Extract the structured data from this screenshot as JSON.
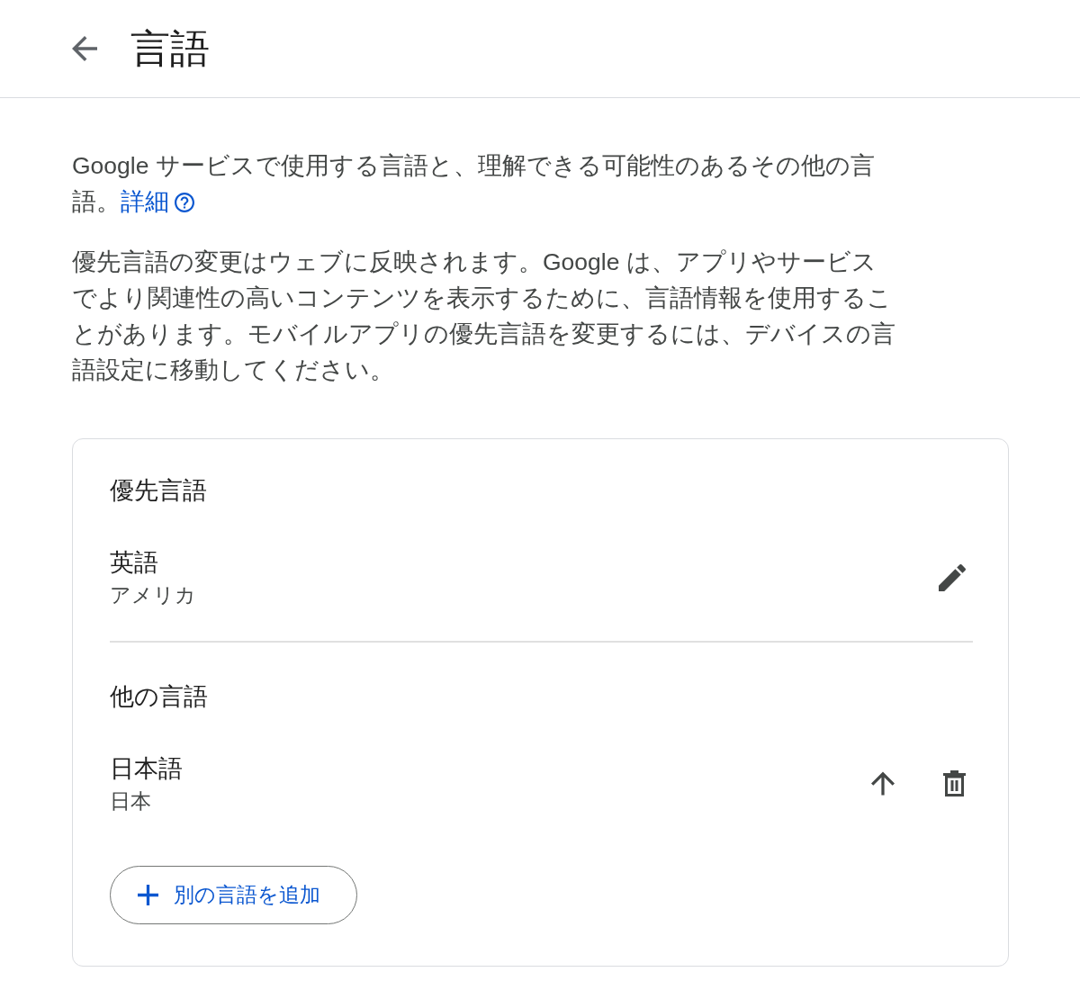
{
  "header": {
    "title": "言語"
  },
  "intro": {
    "text": "Google サービスで使用する言語と、理解できる可能性のあるその他の言語。",
    "link": "詳細"
  },
  "note": "優先言語の変更はウェブに反映されます。Google は、アプリやサービスでより関連性の高いコンテンツを表示するために、言語情報を使用することがあります。モバイルアプリの優先言語を変更するには、デバイスの言語設定に移動してください。",
  "card": {
    "sections": [
      {
        "title": "優先言語",
        "languages": [
          {
            "name": "英語",
            "region": "アメリカ",
            "actions": [
              {
                "kind": "edit"
              }
            ]
          }
        ]
      },
      {
        "title": "他の言語",
        "languages": [
          {
            "name": "日本語",
            "region": "日本",
            "actions": [
              {
                "kind": "move_up"
              },
              {
                "kind": "delete"
              }
            ]
          }
        ]
      }
    ],
    "add_button": "別の言語を追加"
  }
}
